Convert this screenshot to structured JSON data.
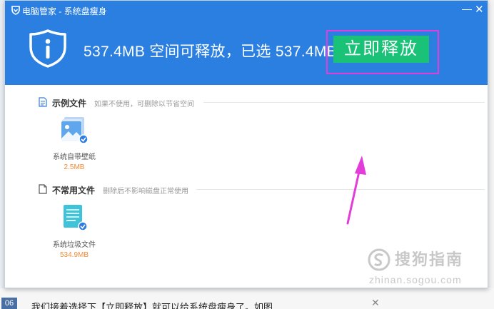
{
  "window": {
    "title": "电脑管家 - 系统盘瘦身",
    "minimize_glyph": "—",
    "close_glyph": "✕"
  },
  "header": {
    "summary": "537.4MB 空间可释放，已选 537.4MB",
    "release_button": "立即释放",
    "brand_color": "#2a7fe0",
    "button_color": "#19c277",
    "highlight_color": "#e23dd8",
    "icon": "shield-icon"
  },
  "sections": [
    {
      "title": "示例文件",
      "description": "如果不使用，可删除以节省空间",
      "icon": "document-icon",
      "items": [
        {
          "label": "系统自带壁纸",
          "size": "2.5MB",
          "icon": "wallpaper-icon",
          "checked": true
        }
      ]
    },
    {
      "title": "不常用文件",
      "description": "删除后不影响磁盘正常使用",
      "icon": "file-icon",
      "items": [
        {
          "label": "系统垃圾文件",
          "size": "534.9MB",
          "icon": "junk-file-icon",
          "checked": true
        }
      ]
    }
  ],
  "watermark": {
    "main": "搜狗指南",
    "sub": "zhinan.sogou.com"
  },
  "background_page": {
    "tag": "06",
    "text": "我们接着选择下【立即释放】就可以给系统盘瘦身了。如图",
    "close_glyph": "✕"
  }
}
